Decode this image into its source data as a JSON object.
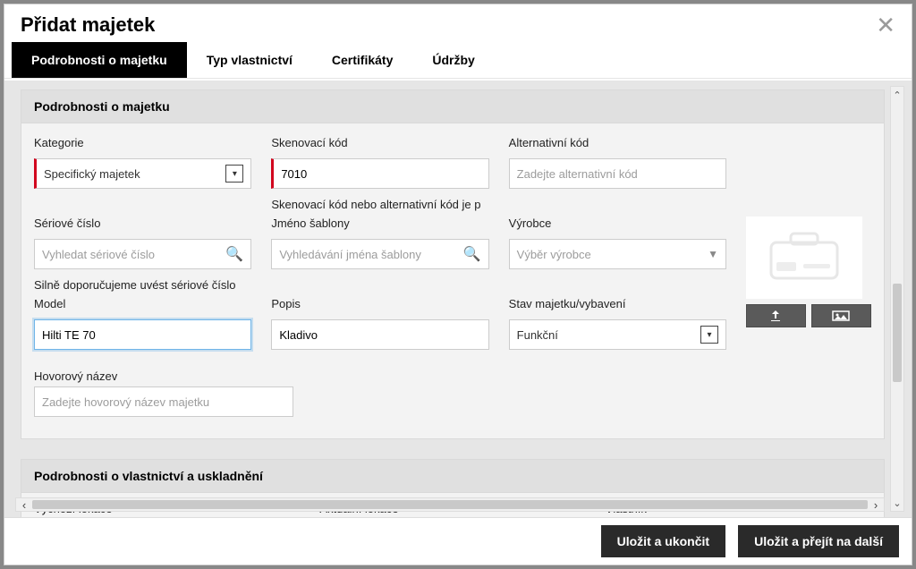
{
  "dialog": {
    "title": "Přidat majetek"
  },
  "tabs": {
    "t0": "Podrobnosti o majetku",
    "t1": "Typ vlastnictví",
    "t2": "Certifikáty",
    "t3": "Údržby"
  },
  "section1": {
    "title": "Podrobnosti o majetku",
    "category": {
      "label": "Kategorie",
      "value": "Specifický majetek"
    },
    "scancode": {
      "label": "Skenovací kód",
      "value": "7010",
      "helper": "Skenovací kód nebo alternativní kód je p"
    },
    "altcode": {
      "label": "Alternativní kód",
      "placeholder": "Zadejte alternativní kód"
    },
    "serial": {
      "label": "Sériové číslo",
      "placeholder": "Vyhledat sériové číslo",
      "helper": "Silně doporučujeme uvést sériové číslo"
    },
    "template": {
      "label": "Jméno šablony",
      "placeholder": "Vyhledávání jména šablony"
    },
    "manufacturer": {
      "label": "Výrobce",
      "placeholder": "Výběr výrobce"
    },
    "model": {
      "label": "Model",
      "value": "Hilti TE 70"
    },
    "description": {
      "label": "Popis",
      "value": "Kladivo"
    },
    "status": {
      "label": "Stav majetku/vybavení",
      "value": "Funkční"
    },
    "friendly": {
      "label": "Hovorový název",
      "placeholder": "Zadejte hovorový název majetku"
    }
  },
  "section2": {
    "title": "Podrobnosti o vlastnictví a uskladnění",
    "col0": "Výchozí lokace",
    "col1": "Aktuální lokace",
    "col2": "Vlastník"
  },
  "footer": {
    "save_exit": "Uložit a ukončit",
    "save_next": "Uložit a přejít na další"
  }
}
